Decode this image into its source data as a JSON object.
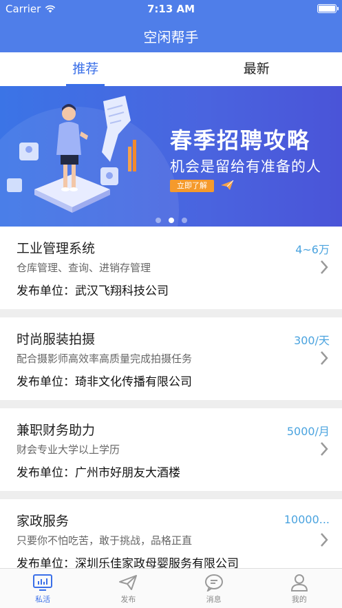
{
  "status_bar": {
    "carrier": "Carrier",
    "time": "7:13 AM"
  },
  "app": {
    "title": "空闲帮手"
  },
  "tabs": [
    {
      "label": "推荐",
      "active": true
    },
    {
      "label": "最新",
      "active": false
    }
  ],
  "banner": {
    "headline": "春季招聘攻略",
    "subline": "机会是留给有准备的人",
    "button_label": "立即了解",
    "slide_count": 3,
    "active_slide": 2
  },
  "jobs": [
    {
      "title": "工业管理系统",
      "salary": "4~6万",
      "description": "仓库管理、查询、进销存管理",
      "publisher_prefix": "发布单位：",
      "publisher": "武汉飞翔科技公司"
    },
    {
      "title": "时尚服装拍摄",
      "salary": "300/天",
      "description": "配合摄影师高效率高质量完成拍摄任务",
      "publisher_prefix": "发布单位：",
      "publisher": "琦非文化传播有限公司"
    },
    {
      "title": "兼职财务助力",
      "salary": "5000/月",
      "description": "财会专业大学以上学历",
      "publisher_prefix": "发布单位：",
      "publisher": "广州市好朋友大酒楼"
    },
    {
      "title": "家政服务",
      "salary": "10000...",
      "description": "只要你不怕吃苦，敢于挑战，品格正直",
      "publisher_prefix": "发布单位：",
      "publisher": "深圳乐佳家政母婴服务有限公司"
    }
  ],
  "bottom_nav": [
    {
      "label": "私活",
      "icon": "chart-board-icon",
      "active": true
    },
    {
      "label": "发布",
      "icon": "paper-plane-icon",
      "active": false
    },
    {
      "label": "消息",
      "icon": "chat-bubble-icon",
      "active": false
    },
    {
      "label": "我的",
      "icon": "person-icon",
      "active": false
    }
  ],
  "colors": {
    "header": "#4f7ee9",
    "accent": "#3a6fe8",
    "salary": "#4aa3df",
    "banner_button": "#f59a2c"
  }
}
